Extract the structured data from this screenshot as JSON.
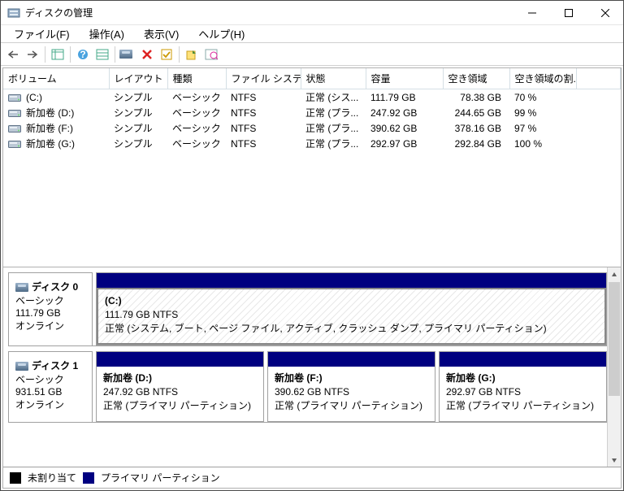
{
  "window": {
    "title": "ディスクの管理"
  },
  "menu": {
    "file": "ファイル(F)",
    "action": "操作(A)",
    "view": "表示(V)",
    "help": "ヘルプ(H)"
  },
  "columns": {
    "volume": "ボリューム",
    "layout": "レイアウト",
    "type": "種類",
    "fs": "ファイル システム",
    "status": "状態",
    "capacity": "容量",
    "free": "空き領域",
    "pct": "空き領域の割..."
  },
  "volumes": [
    {
      "name": "(C:)",
      "layout": "シンプル",
      "type": "ベーシック",
      "fs": "NTFS",
      "status": "正常 (シス...",
      "capacity": "111.79 GB",
      "free": "78.38 GB",
      "pct": "70 %"
    },
    {
      "name": "新加卷 (D:)",
      "layout": "シンプル",
      "type": "ベーシック",
      "fs": "NTFS",
      "status": "正常 (プラ...",
      "capacity": "247.92 GB",
      "free": "244.65 GB",
      "pct": "99 %"
    },
    {
      "name": "新加卷 (F:)",
      "layout": "シンプル",
      "type": "ベーシック",
      "fs": "NTFS",
      "status": "正常 (プラ...",
      "capacity": "390.62 GB",
      "free": "378.16 GB",
      "pct": "97 %"
    },
    {
      "name": "新加卷 (G:)",
      "layout": "シンプル",
      "type": "ベーシック",
      "fs": "NTFS",
      "status": "正常 (プラ...",
      "capacity": "292.97 GB",
      "free": "292.84 GB",
      "pct": "100 %"
    }
  ],
  "disks": [
    {
      "name": "ディスク 0",
      "type": "ベーシック",
      "size": "111.79 GB",
      "state": "オンライン",
      "parts": [
        {
          "title": "(C:)",
          "sub": "111.79 GB NTFS",
          "status": "正常 (システム, ブート, ページ ファイル, アクティブ, クラッシュ ダンプ, プライマリ パーティション)",
          "hatched": true
        }
      ]
    },
    {
      "name": "ディスク 1",
      "type": "ベーシック",
      "size": "931.51 GB",
      "state": "オンライン",
      "parts": [
        {
          "title": "新加卷  (D:)",
          "sub": "247.92 GB NTFS",
          "status": "正常 (プライマリ パーティション)"
        },
        {
          "title": "新加卷  (F:)",
          "sub": "390.62 GB NTFS",
          "status": "正常 (プライマリ パーティション)"
        },
        {
          "title": "新加卷  (G:)",
          "sub": "292.97 GB NTFS",
          "status": "正常 (プライマリ パーティション)"
        }
      ]
    }
  ],
  "legend": {
    "unallocated": "未割り当て",
    "primary": "プライマリ パーティション"
  }
}
